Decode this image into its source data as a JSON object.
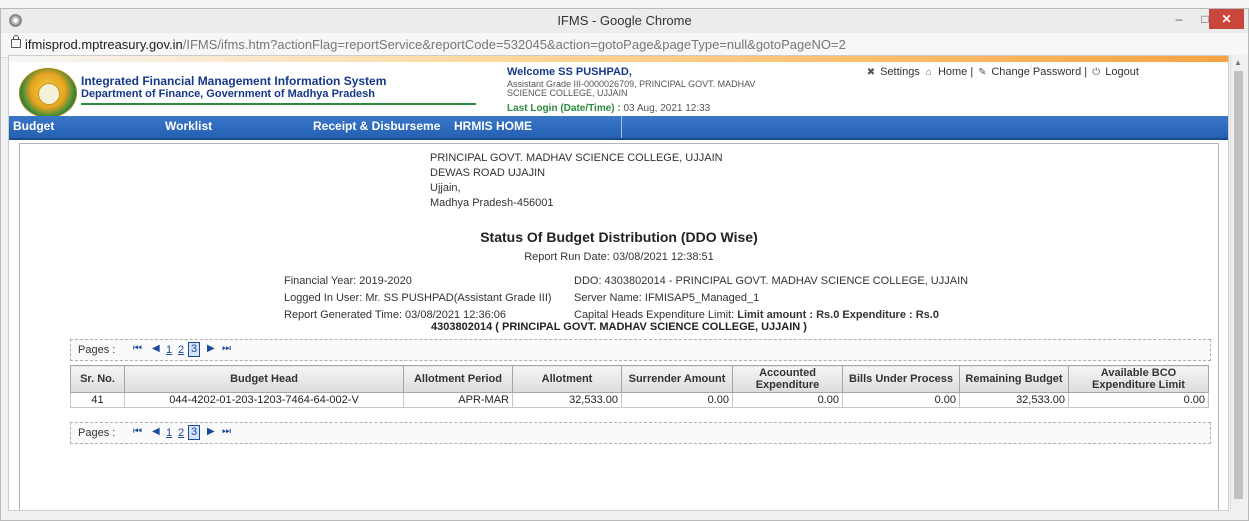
{
  "browser": {
    "title": "IFMS - Google Chrome",
    "url_host": "ifmisprod.mptreasury.gov.in",
    "url_path": "/IFMS/ifms.htm?actionFlag=reportService&reportCode=532045&action=gotoPage&pageType=null&gotoPageNO=2",
    "icons": {
      "app": "chrome-icon",
      "lock": "lock-icon",
      "minimize": "minimize-icon",
      "maximize": "maximize-icon",
      "close": "close-icon"
    }
  },
  "header": {
    "system_title": "Integrated Financial Management Information System",
    "department": "Department of Finance, Government of Madhya Pradesh",
    "welcome": "Welcome SS PUSHPAD,",
    "designation": "Assistant Grade III-0000026709, PRINCIPAL GOVT. MADHAV SCIENCE COLLEGE, UJJAIN",
    "last_login_label": "Last Login (Date/Time) :",
    "last_login_value": "03 Aug, 2021 12:33",
    "links": {
      "settings": "Settings",
      "home": "Home",
      "change_password": "Change Password",
      "logout": "Logout",
      "separator": "|"
    }
  },
  "nav": {
    "items": [
      "Budget",
      "Worklist",
      "Receipt & Disburseme",
      "HRMIS HOME"
    ]
  },
  "report": {
    "address": [
      "PRINCIPAL GOVT. MADHAV SCIENCE COLLEGE, UJJAIN",
      "DEWAS ROAD UJAJIN",
      "Ujjain,",
      "Madhya Pradesh-456001"
    ],
    "title": "Status Of Budget Distribution (DDO Wise)",
    "run_date": "Report Run Date: 03/08/2021 12:38:51",
    "financial_year": "Financial Year: 2019-2020",
    "logged_in_user": "Logged In User: Mr. SS PUSHPAD(Assistant Grade III)",
    "generated_time": "Report Generated Time: 03/08/2021 12:36:06",
    "ddo": "DDO: 4303802014 - PRINCIPAL GOVT. MADHAV SCIENCE COLLEGE, UJJAIN",
    "server_name": "Server Name: IFMISAP5_Managed_1",
    "capital_label": "Capital Heads Expenditure Limit: ",
    "capital_value": "Limit amount : Rs.0 Expenditure : Rs.0",
    "ddo_heading": "4303802014 ( PRINCIPAL GOVT. MADHAV SCIENCE COLLEGE, UJJAIN )"
  },
  "pagination": {
    "label": "Pages :",
    "pages": [
      "1",
      "2",
      "3"
    ],
    "current": "3",
    "icons": [
      "first-page-icon",
      "prev-page-icon",
      "next-page-icon",
      "last-page-icon"
    ]
  },
  "table": {
    "headers": [
      "Sr. No.",
      "Budget Head",
      "Allotment Period",
      "Allotment",
      "Surrender Amount",
      "Accounted Expenditure",
      "Bills Under Process",
      "Remaining Budget",
      "Available BCO Expenditure Limit"
    ],
    "rows": [
      [
        "41",
        "044-4202-01-203-1203-7464-64-002-V",
        "APR-MAR",
        "32,533.00",
        "0.00",
        "0.00",
        "0.00",
        "32,533.00",
        "0.00"
      ]
    ]
  }
}
